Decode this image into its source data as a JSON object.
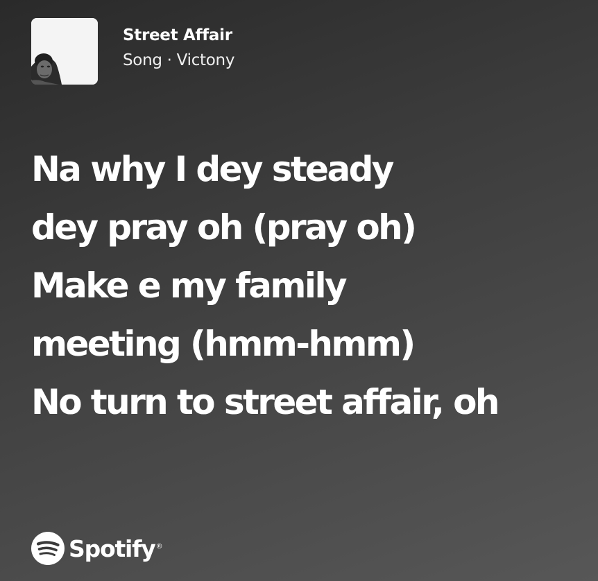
{
  "track": {
    "title": "Street Affair",
    "subtitle": "Song · Victony"
  },
  "lyrics": {
    "lines": [
      "Na why I dey steady",
      "dey pray oh (pray oh)",
      "Make e my family",
      "meeting (hmm-hmm)",
      "No turn to street affair, oh"
    ]
  },
  "brand": {
    "name": "Spotify",
    "mark": "®",
    "icon": "spotify-logo-icon"
  },
  "colors": {
    "background_start": "#2a2a2a",
    "background_end": "#575757",
    "text": "#ffffff"
  }
}
